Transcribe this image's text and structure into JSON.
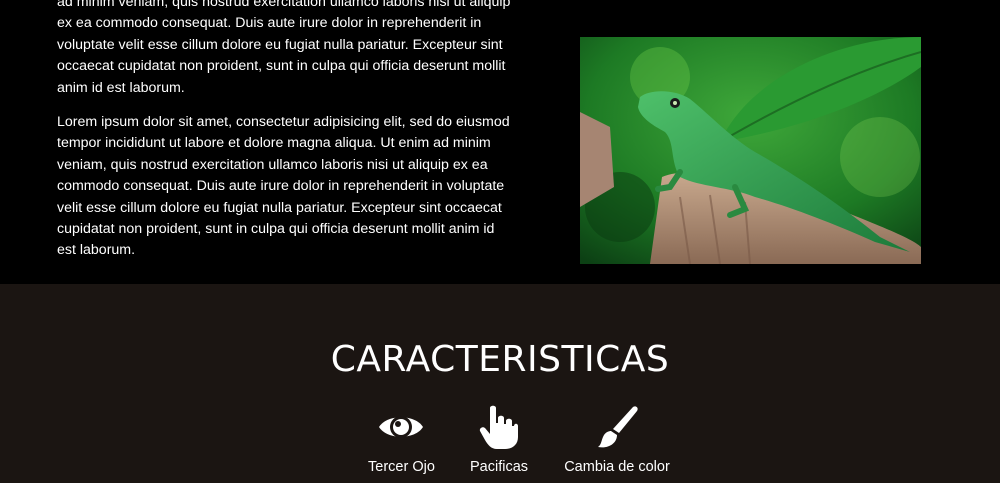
{
  "intro": {
    "paragraph_1": "ad minim veniam, quis nostrud exercitation ullamco laboris nisi ut aliquip ex ea commodo consequat. Duis aute irure dolor in reprehenderit in voluptate velit esse cillum dolore eu fugiat nulla pariatur. Excepteur sint occaecat cupidatat non proident, sunt in culpa qui officia deserunt mollit anim id est laborum.",
    "paragraph_2": "Lorem ipsum dolor sit amet, consectetur adipisicing elit, sed do eiusmod tempor incididunt ut labore et dolore magna aliqua. Ut enim ad minim veniam, quis nostrud exercitation ullamco laboris nisi ut aliquip ex ea commodo consequat. Duis aute irure dolor in reprehenderit in voluptate velit esse cillum dolore eu fugiat nulla pariatur. Excepteur sint occaecat cupidatat non proident, sunt in culpa qui officia deserunt mollit anim id est laborum."
  },
  "features": {
    "title": "CARACTERISTICAS",
    "items": [
      {
        "label": "Tercer Ojo",
        "icon": "eye-icon"
      },
      {
        "label": "Pacificas",
        "icon": "hand-pointer-icon"
      },
      {
        "label": "Cambia de color",
        "icon": "paint-brush-icon"
      }
    ]
  },
  "colors": {
    "top_background": "#000000",
    "features_background": "#1b1512",
    "text": "#ffffff"
  }
}
